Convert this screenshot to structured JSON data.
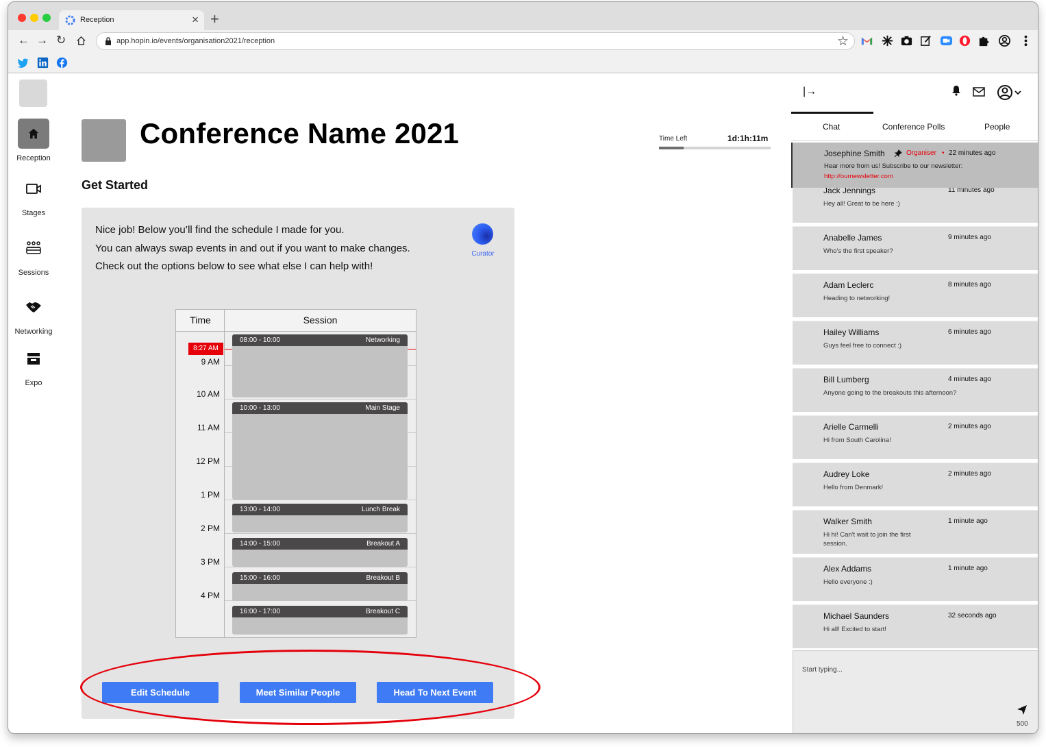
{
  "browser": {
    "tab_title": "Reception",
    "url": "app.hopin.io/events/organisation2021/reception",
    "new_tab_symbol": "+",
    "close_symbol": "×"
  },
  "nav": {
    "items": [
      {
        "label": "Reception",
        "icon": "home-icon",
        "active": true
      },
      {
        "label": "Stages",
        "icon": "video-icon"
      },
      {
        "label": "Sessions",
        "icon": "people-group-icon"
      },
      {
        "label": "Networking",
        "icon": "handshake-icon"
      },
      {
        "label": "Expo",
        "icon": "store-icon"
      }
    ]
  },
  "header": {
    "conference_name": "Conference Name 2021",
    "time_left_label": "Time Left",
    "time_left_value": "1d:1h:11m",
    "time_left_progress": 0.22,
    "get_started": "Get Started"
  },
  "curator": {
    "name": "Curator",
    "lines": [
      "Nice job! Below you’ll find the schedule I made for you.",
      "You can always swap events in and out if you want to make changes.",
      "Check out the options below to see what else I can help with!"
    ]
  },
  "schedule": {
    "col_time": "Time",
    "col_session": "Session",
    "now_label": "8:27 AM",
    "hours": [
      "9 AM",
      "10 AM",
      "11 AM",
      "12 PM",
      "1 PM",
      "2 PM",
      "3 PM",
      "4 PM"
    ],
    "events": [
      {
        "time": "08:00 - 10:00",
        "name": "Networking"
      },
      {
        "time": "10:00 - 13:00",
        "name": "Main Stage"
      },
      {
        "time": "13:00 - 14:00",
        "name": "Lunch Break"
      },
      {
        "time": "14:00 - 15:00",
        "name": "Breakout A"
      },
      {
        "time": "15:00 - 16:00",
        "name": "Breakout B"
      },
      {
        "time": "16:00 - 17:00",
        "name": "Breakout C"
      }
    ]
  },
  "actions": {
    "edit_schedule": "Edit Schedule",
    "meet_similar": "Meet Similar People",
    "next_event": "Head To Next Event"
  },
  "right_panel": {
    "collapse_symbol": "|→",
    "tabs": [
      "Chat",
      "Conference Polls",
      "People"
    ],
    "active_tab": "Chat",
    "pinned": {
      "name": "Josephine Smith",
      "role": "Organiser",
      "separator": "•",
      "time": "22 minutes ago",
      "text": "Hear more from us! Subscribe to our newsletter:",
      "link": "http://ournewsletter.com"
    },
    "messages": [
      {
        "name": "Jack Jennings",
        "time": "11 minutes ago",
        "text": "Hey all! Great to be here :)"
      },
      {
        "name": "Anabelle James",
        "time": "9 minutes ago",
        "text": "Who's the first speaker?"
      },
      {
        "name": "Adam Leclerc",
        "time": "8 minutes ago",
        "text": "Heading to networking!"
      },
      {
        "name": "Hailey Williams",
        "time": "6 minutes ago",
        "text": "Guys feel free to connect :)"
      },
      {
        "name": "Bill Lumberg",
        "time": "4 minutes ago",
        "text": "Anyone going to the breakouts this afternoon?"
      },
      {
        "name": "Arielle Carmelli",
        "time": "2 minutes ago",
        "text": "Hi from South Carolina!"
      },
      {
        "name": "Audrey Loke",
        "time": "2 minutes ago",
        "text": "Hello from Denmark!"
      },
      {
        "name": "Walker Smith",
        "time": "1 minute ago",
        "text": "Hi hi! Can't wait to join the first session."
      },
      {
        "name": "Alex Addams",
        "time": "1 minute ago",
        "text": "Hello everyone :)"
      },
      {
        "name": "Michael Saunders",
        "time": "32 seconds ago",
        "text": "Hi all! Excited to start!"
      }
    ],
    "composer_placeholder": "Start typing...",
    "char_limit": "500"
  },
  "colors": {
    "accent": "#3e7bf4",
    "alert": "#e6000a",
    "nav_active": "#7b7b7b",
    "event_bar": "#4a4848"
  }
}
